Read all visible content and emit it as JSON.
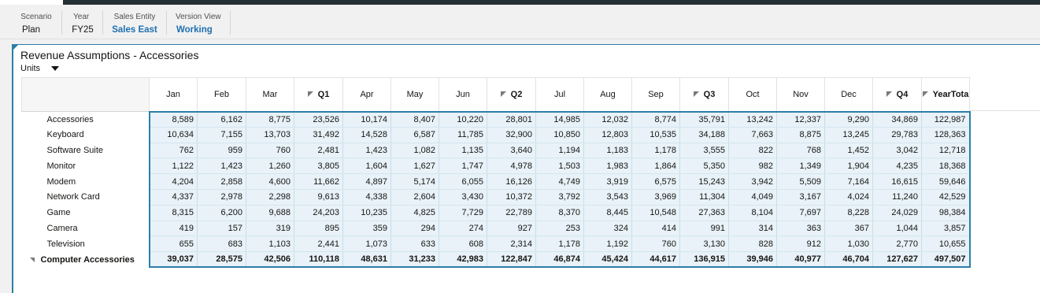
{
  "pov": [
    {
      "label": "Scenario",
      "value": "Plan",
      "link": false
    },
    {
      "label": "Year",
      "value": "FY25",
      "link": false
    },
    {
      "label": "Sales Entity",
      "value": "Sales East",
      "link": true
    },
    {
      "label": "Version View",
      "value": "Working",
      "link": true
    }
  ],
  "form": {
    "title": "Revenue Assumptions - Accessories",
    "units_label": "Units"
  },
  "grid": {
    "columns": [
      {
        "label": "Jan",
        "total": false
      },
      {
        "label": "Feb",
        "total": false
      },
      {
        "label": "Mar",
        "total": false
      },
      {
        "label": "Q1",
        "total": true
      },
      {
        "label": "Apr",
        "total": false
      },
      {
        "label": "May",
        "total": false
      },
      {
        "label": "Jun",
        "total": false
      },
      {
        "label": "Q2",
        "total": true
      },
      {
        "label": "Jul",
        "total": false
      },
      {
        "label": "Aug",
        "total": false
      },
      {
        "label": "Sep",
        "total": false
      },
      {
        "label": "Q3",
        "total": true
      },
      {
        "label": "Oct",
        "total": false
      },
      {
        "label": "Nov",
        "total": false
      },
      {
        "label": "Dec",
        "total": false
      },
      {
        "label": "Q4",
        "total": true
      },
      {
        "label": "YearTota",
        "total": true
      }
    ],
    "rows": [
      {
        "label": "Accessories",
        "values": [
          "8,589",
          "6,162",
          "8,775",
          "23,526",
          "10,174",
          "8,407",
          "10,220",
          "28,801",
          "14,985",
          "12,032",
          "8,774",
          "35,791",
          "13,242",
          "12,337",
          "9,290",
          "34,869",
          "122,987"
        ]
      },
      {
        "label": "Keyboard",
        "values": [
          "10,634",
          "7,155",
          "13,703",
          "31,492",
          "14,528",
          "6,587",
          "11,785",
          "32,900",
          "10,850",
          "12,803",
          "10,535",
          "34,188",
          "7,663",
          "8,875",
          "13,245",
          "29,783",
          "128,363"
        ]
      },
      {
        "label": "Software Suite",
        "values": [
          "762",
          "959",
          "760",
          "2,481",
          "1,423",
          "1,082",
          "1,135",
          "3,640",
          "1,194",
          "1,183",
          "1,178",
          "3,555",
          "822",
          "768",
          "1,452",
          "3,042",
          "12,718"
        ]
      },
      {
        "label": "Monitor",
        "values": [
          "1,122",
          "1,423",
          "1,260",
          "3,805",
          "1,604",
          "1,627",
          "1,747",
          "4,978",
          "1,503",
          "1,983",
          "1,864",
          "5,350",
          "982",
          "1,349",
          "1,904",
          "4,235",
          "18,368"
        ]
      },
      {
        "label": "Modem",
        "values": [
          "4,204",
          "2,858",
          "4,600",
          "11,662",
          "4,897",
          "5,174",
          "6,055",
          "16,126",
          "4,749",
          "3,919",
          "6,575",
          "15,243",
          "3,942",
          "5,509",
          "7,164",
          "16,615",
          "59,646"
        ]
      },
      {
        "label": "Network Card",
        "values": [
          "4,337",
          "2,978",
          "2,298",
          "9,613",
          "4,338",
          "2,604",
          "3,430",
          "10,372",
          "3,792",
          "3,543",
          "3,969",
          "11,304",
          "4,049",
          "3,167",
          "4,024",
          "11,240",
          "42,529"
        ]
      },
      {
        "label": "Game",
        "values": [
          "8,315",
          "6,200",
          "9,688",
          "24,203",
          "10,235",
          "4,825",
          "7,729",
          "22,789",
          "8,370",
          "8,445",
          "10,548",
          "27,363",
          "8,104",
          "7,697",
          "8,228",
          "24,029",
          "98,384"
        ]
      },
      {
        "label": "Camera",
        "values": [
          "419",
          "157",
          "319",
          "895",
          "359",
          "294",
          "274",
          "927",
          "253",
          "324",
          "414",
          "991",
          "314",
          "363",
          "367",
          "1,044",
          "3,857"
        ]
      },
      {
        "label": "Television",
        "values": [
          "655",
          "683",
          "1,103",
          "2,441",
          "1,073",
          "633",
          "608",
          "2,314",
          "1,178",
          "1,192",
          "760",
          "3,130",
          "828",
          "912",
          "1,030",
          "2,770",
          "10,655"
        ]
      }
    ],
    "total_row": {
      "label": "Computer Accessories",
      "values": [
        "39,037",
        "28,575",
        "42,506",
        "110,118",
        "48,631",
        "31,233",
        "42,983",
        "122,847",
        "46,874",
        "45,424",
        "44,617",
        "136,915",
        "39,946",
        "40,977",
        "46,704",
        "127,627",
        "497,507"
      ]
    }
  }
}
